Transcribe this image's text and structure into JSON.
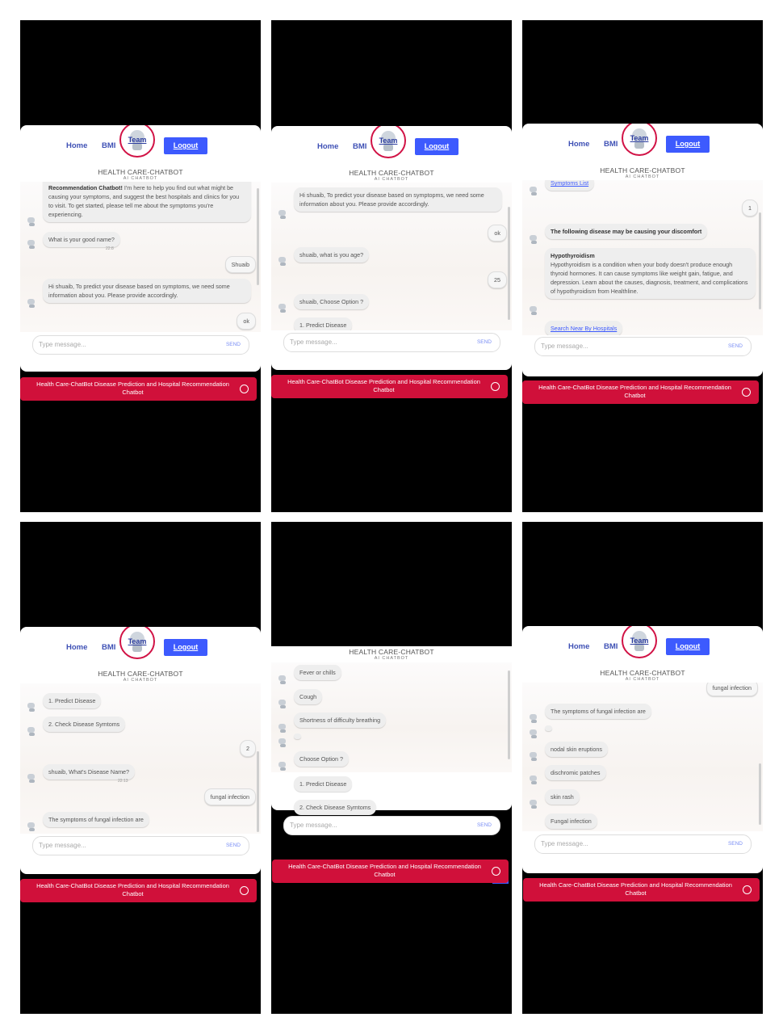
{
  "nav": {
    "home": "Home",
    "bmi": "BMI",
    "team": "Team",
    "logout": "Logout"
  },
  "brand": {
    "title": "HEALTH CARE-CHATBOT",
    "subtitle": "AI CHATBOT"
  },
  "input": {
    "placeholder": "Type message...",
    "send": "SEND"
  },
  "footer": {
    "text": "Health Care-ChatBot Disease Prediction and Hospital Recommendation Chatbot"
  },
  "screens": [
    {
      "messages": [
        {
          "from": "bot",
          "bold": "Recommendation Chatbot!",
          "text": " I'm here to help you find out what might be causing your symptoms, and suggest the best hospitals and clinics for you to visit. To get started, please tell me about the symptoms you're experiencing."
        },
        {
          "from": "bot",
          "text": "What is your good name?",
          "time": "22:8"
        },
        {
          "from": "user",
          "text": "Shuaib"
        },
        {
          "from": "bot",
          "text": "Hi shuaib, To predict your disease based on symptoms, we need some information about you. Please provide accordingly."
        },
        {
          "from": "user",
          "text": "ok"
        }
      ]
    },
    {
      "messages": [
        {
          "from": "bot",
          "text": "Hi shuaib, To predict your disease based on symptopms, we need some information about you. Please provide accordingly."
        },
        {
          "from": "user",
          "text": "ok"
        },
        {
          "from": "bot",
          "text": "shuaib, what is you age?"
        },
        {
          "from": "user",
          "text": "25"
        },
        {
          "from": "bot",
          "text": "shuaib, Choose Option ?"
        },
        {
          "from": "bot",
          "text": "1. Predict Disease"
        }
      ]
    },
    {
      "messages": [
        {
          "from": "bot",
          "text": "Symptoms List"
        },
        {
          "from": "user",
          "text": "1"
        },
        {
          "from": "bot",
          "text": "The following disease may be causing your discomfort"
        },
        {
          "from": "bot",
          "title": "Hypothyroidism",
          "text": "Hypothyroidism is a condition when your body doesn't produce enough thyroid hormones. It can cause symptoms like weight gain, fatigue, and depression. Learn about the causes, diagnosis, treatment, and complications of hypothyroidism from Healthline."
        },
        {
          "from": "bot",
          "text": "Search Near By Hospitals"
        }
      ]
    },
    {
      "messages": [
        {
          "from": "bot",
          "text": "1. Predict Disease"
        },
        {
          "from": "bot",
          "text": "2. Check Disease Symtoms"
        },
        {
          "from": "user",
          "text": "2"
        },
        {
          "from": "bot",
          "text": "shuaib, What's Disease Name?",
          "time": "22:13"
        },
        {
          "from": "user",
          "text": "fungal infection"
        },
        {
          "from": "bot",
          "text": "The symptoms of fungal infection are"
        }
      ]
    },
    {
      "messages": [
        {
          "from": "bot",
          "text": "Fever or chills"
        },
        {
          "from": "bot",
          "text": "Cough"
        },
        {
          "from": "bot",
          "text": "Shortness of difficulty breathing"
        },
        {
          "from": "bot",
          "text": ""
        },
        {
          "from": "bot",
          "text": "Choose Option ?"
        },
        {
          "from": "bot",
          "text": "1. Predict Disease"
        },
        {
          "from": "bot",
          "text": "2. Check Disease Symtoms"
        }
      ]
    },
    {
      "messages": [
        {
          "from": "user",
          "text": "fungal infection"
        },
        {
          "from": "bot",
          "text": "The symptoms of fungal infection are"
        },
        {
          "from": "bot",
          "text": ""
        },
        {
          "from": "bot",
          "text": "nodal skin eruptions"
        },
        {
          "from": "bot",
          "text": "dischromic patches"
        },
        {
          "from": "bot",
          "text": "skin rash"
        },
        {
          "from": "bot",
          "text": "Fungal infection"
        }
      ]
    }
  ]
}
